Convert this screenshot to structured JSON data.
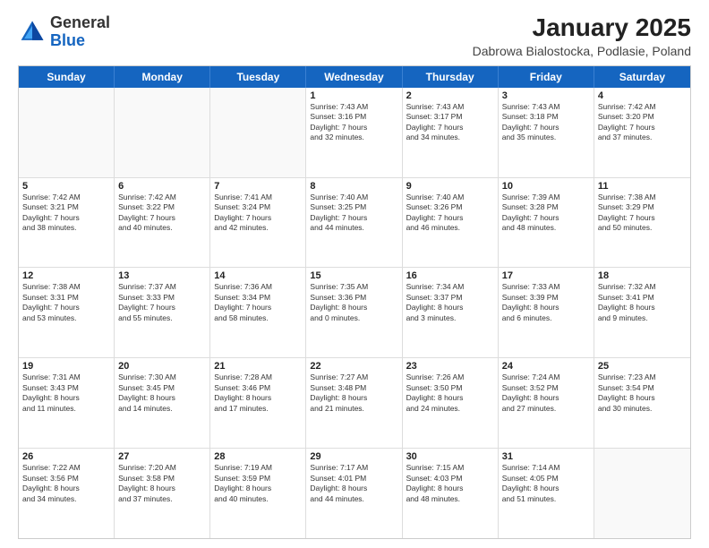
{
  "logo": {
    "general": "General",
    "blue": "Blue"
  },
  "header": {
    "month_year": "January 2025",
    "location": "Dabrowa Bialostocka, Podlasie, Poland"
  },
  "days_of_week": [
    "Sunday",
    "Monday",
    "Tuesday",
    "Wednesday",
    "Thursday",
    "Friday",
    "Saturday"
  ],
  "weeks": [
    [
      {
        "day": "",
        "info": ""
      },
      {
        "day": "",
        "info": ""
      },
      {
        "day": "",
        "info": ""
      },
      {
        "day": "1",
        "info": "Sunrise: 7:43 AM\nSunset: 3:16 PM\nDaylight: 7 hours\nand 32 minutes."
      },
      {
        "day": "2",
        "info": "Sunrise: 7:43 AM\nSunset: 3:17 PM\nDaylight: 7 hours\nand 34 minutes."
      },
      {
        "day": "3",
        "info": "Sunrise: 7:43 AM\nSunset: 3:18 PM\nDaylight: 7 hours\nand 35 minutes."
      },
      {
        "day": "4",
        "info": "Sunrise: 7:42 AM\nSunset: 3:20 PM\nDaylight: 7 hours\nand 37 minutes."
      }
    ],
    [
      {
        "day": "5",
        "info": "Sunrise: 7:42 AM\nSunset: 3:21 PM\nDaylight: 7 hours\nand 38 minutes."
      },
      {
        "day": "6",
        "info": "Sunrise: 7:42 AM\nSunset: 3:22 PM\nDaylight: 7 hours\nand 40 minutes."
      },
      {
        "day": "7",
        "info": "Sunrise: 7:41 AM\nSunset: 3:24 PM\nDaylight: 7 hours\nand 42 minutes."
      },
      {
        "day": "8",
        "info": "Sunrise: 7:40 AM\nSunset: 3:25 PM\nDaylight: 7 hours\nand 44 minutes."
      },
      {
        "day": "9",
        "info": "Sunrise: 7:40 AM\nSunset: 3:26 PM\nDaylight: 7 hours\nand 46 minutes."
      },
      {
        "day": "10",
        "info": "Sunrise: 7:39 AM\nSunset: 3:28 PM\nDaylight: 7 hours\nand 48 minutes."
      },
      {
        "day": "11",
        "info": "Sunrise: 7:38 AM\nSunset: 3:29 PM\nDaylight: 7 hours\nand 50 minutes."
      }
    ],
    [
      {
        "day": "12",
        "info": "Sunrise: 7:38 AM\nSunset: 3:31 PM\nDaylight: 7 hours\nand 53 minutes."
      },
      {
        "day": "13",
        "info": "Sunrise: 7:37 AM\nSunset: 3:33 PM\nDaylight: 7 hours\nand 55 minutes."
      },
      {
        "day": "14",
        "info": "Sunrise: 7:36 AM\nSunset: 3:34 PM\nDaylight: 7 hours\nand 58 minutes."
      },
      {
        "day": "15",
        "info": "Sunrise: 7:35 AM\nSunset: 3:36 PM\nDaylight: 8 hours\nand 0 minutes."
      },
      {
        "day": "16",
        "info": "Sunrise: 7:34 AM\nSunset: 3:37 PM\nDaylight: 8 hours\nand 3 minutes."
      },
      {
        "day": "17",
        "info": "Sunrise: 7:33 AM\nSunset: 3:39 PM\nDaylight: 8 hours\nand 6 minutes."
      },
      {
        "day": "18",
        "info": "Sunrise: 7:32 AM\nSunset: 3:41 PM\nDaylight: 8 hours\nand 9 minutes."
      }
    ],
    [
      {
        "day": "19",
        "info": "Sunrise: 7:31 AM\nSunset: 3:43 PM\nDaylight: 8 hours\nand 11 minutes."
      },
      {
        "day": "20",
        "info": "Sunrise: 7:30 AM\nSunset: 3:45 PM\nDaylight: 8 hours\nand 14 minutes."
      },
      {
        "day": "21",
        "info": "Sunrise: 7:28 AM\nSunset: 3:46 PM\nDaylight: 8 hours\nand 17 minutes."
      },
      {
        "day": "22",
        "info": "Sunrise: 7:27 AM\nSunset: 3:48 PM\nDaylight: 8 hours\nand 21 minutes."
      },
      {
        "day": "23",
        "info": "Sunrise: 7:26 AM\nSunset: 3:50 PM\nDaylight: 8 hours\nand 24 minutes."
      },
      {
        "day": "24",
        "info": "Sunrise: 7:24 AM\nSunset: 3:52 PM\nDaylight: 8 hours\nand 27 minutes."
      },
      {
        "day": "25",
        "info": "Sunrise: 7:23 AM\nSunset: 3:54 PM\nDaylight: 8 hours\nand 30 minutes."
      }
    ],
    [
      {
        "day": "26",
        "info": "Sunrise: 7:22 AM\nSunset: 3:56 PM\nDaylight: 8 hours\nand 34 minutes."
      },
      {
        "day": "27",
        "info": "Sunrise: 7:20 AM\nSunset: 3:58 PM\nDaylight: 8 hours\nand 37 minutes."
      },
      {
        "day": "28",
        "info": "Sunrise: 7:19 AM\nSunset: 3:59 PM\nDaylight: 8 hours\nand 40 minutes."
      },
      {
        "day": "29",
        "info": "Sunrise: 7:17 AM\nSunset: 4:01 PM\nDaylight: 8 hours\nand 44 minutes."
      },
      {
        "day": "30",
        "info": "Sunrise: 7:15 AM\nSunset: 4:03 PM\nDaylight: 8 hours\nand 48 minutes."
      },
      {
        "day": "31",
        "info": "Sunrise: 7:14 AM\nSunset: 4:05 PM\nDaylight: 8 hours\nand 51 minutes."
      },
      {
        "day": "",
        "info": ""
      }
    ]
  ]
}
